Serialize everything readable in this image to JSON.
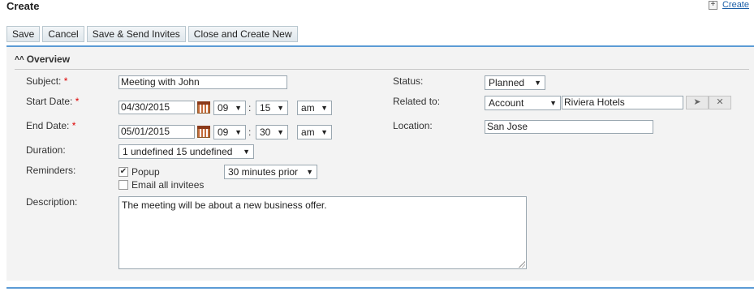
{
  "header": {
    "title": "Create",
    "create_link": "Create"
  },
  "toolbar": {
    "save": "Save",
    "cancel": "Cancel",
    "save_send": "Save & Send Invites",
    "close_create": "Close and Create New"
  },
  "section": {
    "title": "Overview"
  },
  "form": {
    "subject_label": "Subject:",
    "subject_value": "Meeting with John",
    "start_label": "Start Date:",
    "start_date": "04/30/2015",
    "start_hour": "09",
    "start_minute": "15",
    "start_ampm": "am",
    "end_label": "End Date:",
    "end_date": "05/01/2015",
    "end_hour": "09",
    "end_minute": "30",
    "end_ampm": "am",
    "duration_label": "Duration:",
    "duration_value": "1 undefined 15 undefined",
    "reminders_label": "Reminders:",
    "popup_label": "Popup",
    "popup_checked": true,
    "reminder_time": "30 minutes prior",
    "email_invitees_label": "Email all invitees",
    "email_invitees_checked": false,
    "description_label": "Description:",
    "description_value": "The meeting will be about a new business offer.",
    "status_label": "Status:",
    "status_value": "Planned",
    "related_label": "Related to:",
    "related_type": "Account",
    "related_value": "Riviera Hotels",
    "location_label": "Location:",
    "location_value": "San Jose",
    "required_mark": "*",
    "colon": ":"
  },
  "icons": {
    "plus": "plus-icon",
    "collapse": "double-chevron-up-icon",
    "calendar": "calendar-icon",
    "select": "cursor-arrow-icon",
    "clear": "close-icon",
    "dropdown": "triangle-down-icon",
    "check": "check-icon"
  }
}
